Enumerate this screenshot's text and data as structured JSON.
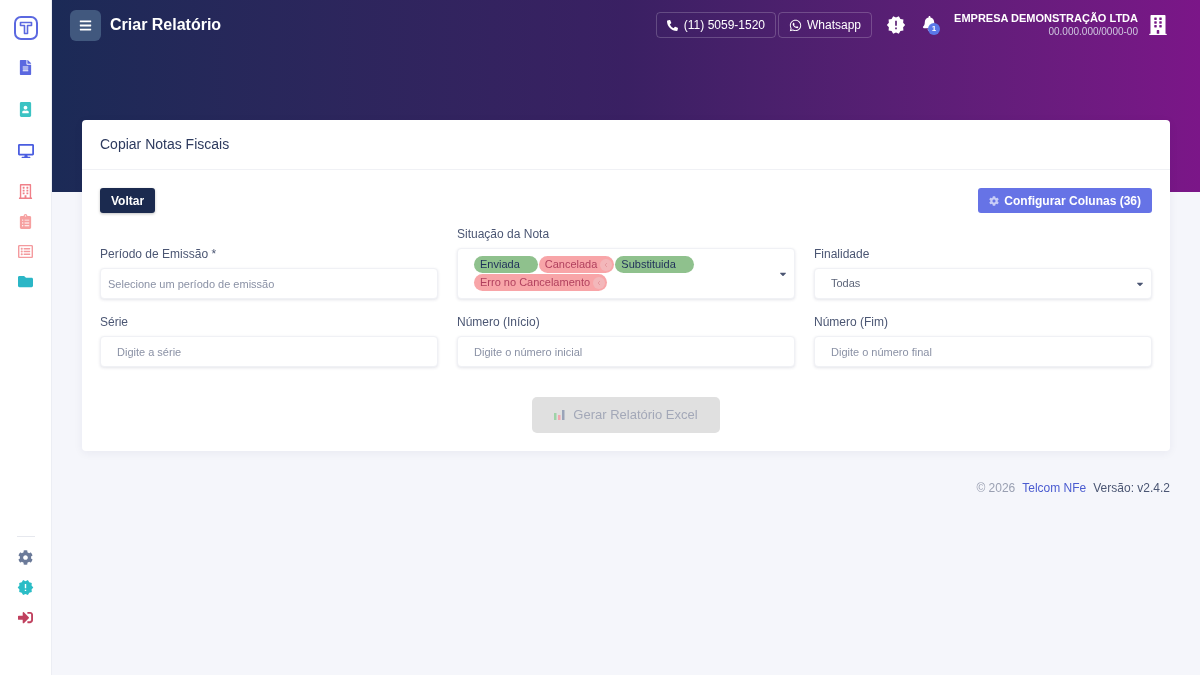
{
  "header": {
    "title": "Criar Relatório",
    "phone": "(11) 5059-1520",
    "whatsapp": "Whatsapp",
    "notification_count": "1",
    "company_name": "EMPRESA DEMONSTRAÇÃO LTDA",
    "company_id": "00.000.000/0000-00"
  },
  "card": {
    "title": "Copiar Notas Fiscais",
    "back_button": "Voltar",
    "columns_button": "Configurar Colunas (36)",
    "fields": [
      {
        "kind": "input",
        "label": "Período de Emissão *",
        "placeholder": "Selecione um período de emissão"
      },
      {
        "kind": "multiselect",
        "label": "Situação da Nota",
        "tags": [
          {
            "label": "Enviada",
            "color": "#8fc18d",
            "removable": false
          },
          {
            "label": "Cancelada",
            "color": "#f8a5a8",
            "removable": true
          },
          {
            "label": "Substituida",
            "color": "#8fc18d",
            "removable": false
          },
          {
            "label": "Erro no Cancelamento",
            "color": "#f8a5a8",
            "removable": true
          }
        ]
      },
      {
        "kind": "select",
        "label": "Finalidade",
        "value": "Todas"
      },
      {
        "kind": "input",
        "label": "Série",
        "placeholder": "Digite a série"
      },
      {
        "kind": "input",
        "label": "Número (Início)",
        "placeholder": "Digite o número inicial"
      },
      {
        "kind": "input",
        "label": "Número (Fim)",
        "placeholder": "Digite o número final"
      }
    ],
    "generate_button": {
      "label": "Gerar Relatório Excel",
      "disabled": true
    }
  },
  "footer": {
    "copyright": "© 2026",
    "brand": "Telcom NFe",
    "version": "Versão: v2.4.2"
  }
}
